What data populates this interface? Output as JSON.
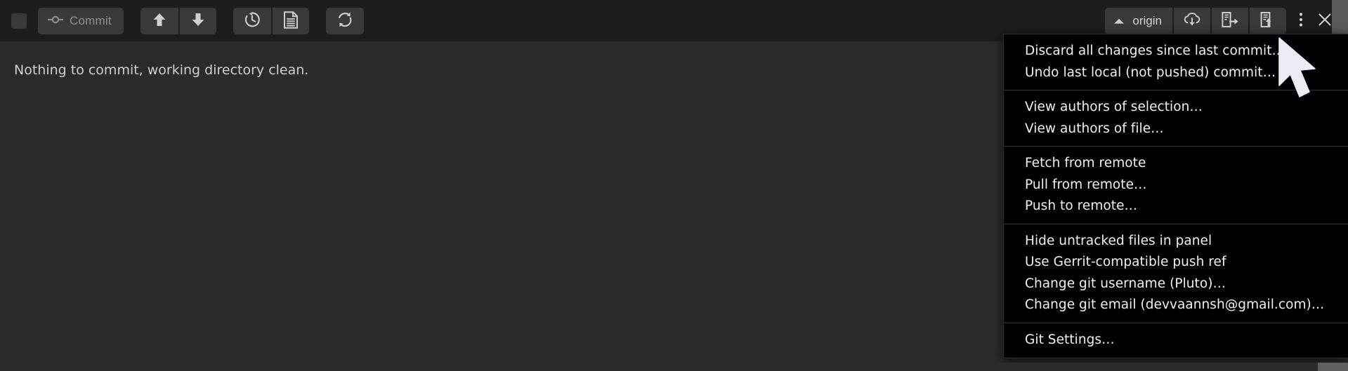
{
  "toolbar": {
    "checkbox_name": "stage-all-checkbox",
    "commit_label": "Commit",
    "buttons": [
      {
        "name": "push-arrow-up-button",
        "icon": "arrow-up-icon",
        "tooltip": "Push"
      },
      {
        "name": "pull-arrow-down-button",
        "icon": "arrow-down-icon",
        "tooltip": "Pull"
      },
      {
        "name": "history-button",
        "icon": "history-revert-icon",
        "tooltip": "History"
      },
      {
        "name": "file-history-button",
        "icon": "file-document-icon",
        "tooltip": "File History"
      },
      {
        "name": "refresh-button",
        "icon": "refresh-icon",
        "tooltip": "Refresh"
      }
    ],
    "origin_label": "origin",
    "right_buttons": [
      {
        "name": "fetch-button",
        "icon": "cloud-download-icon"
      },
      {
        "name": "pull-from-remote-button",
        "icon": "file-arrow-right-icon"
      },
      {
        "name": "push-to-remote-button",
        "icon": "file-arrow-up-icon"
      }
    ],
    "kebab_name": "more-options-button",
    "close_label": "×"
  },
  "main": {
    "status_message": "Nothing to commit, working directory clean."
  },
  "menu": {
    "groups": [
      {
        "items": [
          {
            "label": "Discard all changes since last commit…",
            "name": "menu-discard-all-changes"
          },
          {
            "label": "Undo last local (not pushed) commit…",
            "name": "menu-undo-last-local-commit"
          }
        ]
      },
      {
        "items": [
          {
            "label": "View authors of selection…",
            "name": "menu-view-authors-of-selection"
          },
          {
            "label": "View authors of file…",
            "name": "menu-view-authors-of-file"
          }
        ]
      },
      {
        "items": [
          {
            "label": "Fetch from remote",
            "name": "menu-fetch-from-remote"
          },
          {
            "label": "Pull from remote…",
            "name": "menu-pull-from-remote"
          },
          {
            "label": "Push to remote…",
            "name": "menu-push-to-remote"
          }
        ]
      },
      {
        "items": [
          {
            "label": "Hide untracked files in panel",
            "name": "menu-hide-untracked-files"
          },
          {
            "label": "Use Gerrit-compatible push ref",
            "name": "menu-use-gerrit-push-ref"
          },
          {
            "label": "Change git username (Pluto)…",
            "name": "menu-change-git-username"
          },
          {
            "label": "Change git email (devvaannsh@gmail.com)…",
            "name": "menu-change-git-email"
          }
        ]
      },
      {
        "items": [
          {
            "label": "Git Settings…",
            "name": "menu-git-settings"
          }
        ]
      }
    ]
  },
  "colors": {
    "toolbar_bg": "#1d1d1d",
    "content_bg": "#2b2b2b",
    "menu_bg": "#000000",
    "button_bg": "#3a3a3a",
    "text": "#cfcfcf",
    "menu_text": "#f0f0f0",
    "scroll_thumb": "#5f5f5f"
  }
}
